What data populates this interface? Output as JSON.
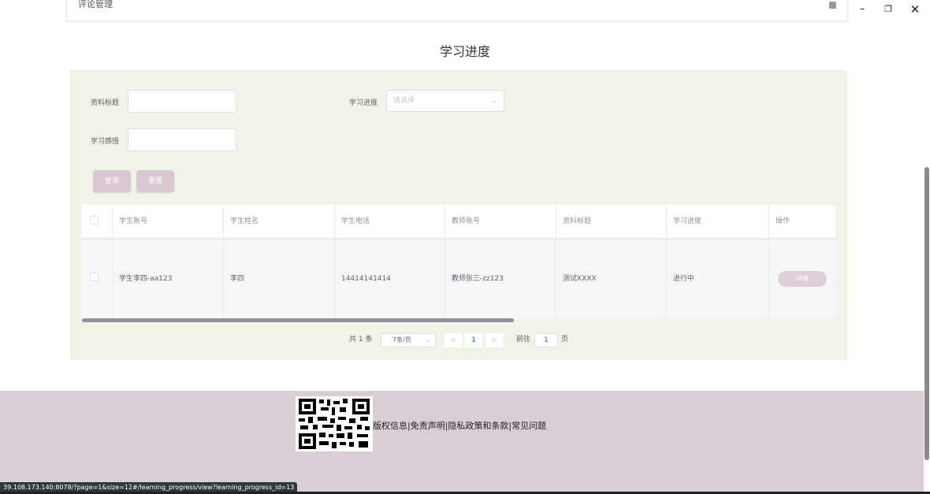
{
  "window": {
    "minimize": "–",
    "restore": "❐",
    "close": "✕"
  },
  "topbar": {
    "label": "评论管理"
  },
  "page": {
    "title": "学习进度"
  },
  "search": {
    "title_label": "资料标题",
    "progress_label": "学习进度",
    "progress_placeholder": "请选择",
    "feeling_label": "学习感悟",
    "query_btn": "查询",
    "reset_btn": "重置"
  },
  "table": {
    "headers": [
      "学生账号",
      "学生姓名",
      "学生电话",
      "教师账号",
      "资料标题",
      "学习进度",
      "操作"
    ],
    "rows": [
      {
        "student_account": "学生李四-aa123",
        "student_name": "李四",
        "student_phone": "14414141414",
        "teacher_account": "教师张三-zz123",
        "title": "测试XXXX",
        "progress": "进行中",
        "action": "详情"
      }
    ]
  },
  "pagination": {
    "total": "共 1 条",
    "page_size": "7条/页",
    "prev": "<",
    "current": "1",
    "next": ">",
    "goto_label": "前往",
    "goto_value": "1",
    "page_suffix": "页"
  },
  "footer": {
    "links": "版权信息|免责声明|隐私政策和条款|常见问题"
  },
  "statusbar": {
    "url": "39.108.173.140:8078/?page=1&size=12#/learning_progress/view?learning_progress_id=13"
  }
}
